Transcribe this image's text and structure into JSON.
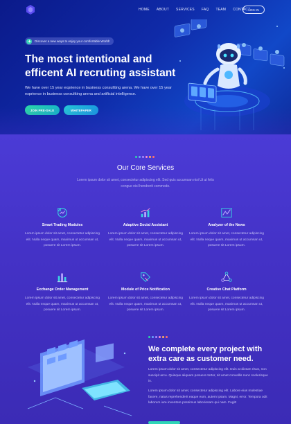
{
  "nav": {
    "items": [
      "HOME",
      "ABOUT",
      "SERVICES",
      "FAQ",
      "TEAM",
      "CONTACT"
    ],
    "login_label": "LOG IN"
  },
  "hero": {
    "pill_text": "Discover a new ways to enjoy your comfortable World!",
    "title": "The most intentional and efficent AI recruting assistant",
    "text": "We have over 15 year exprience in business consultting arena. We have over 15 year exprience in business consultting arena and artificial intelligence.",
    "btn_presale": "JOIN PRE-SALE",
    "btn_whitepaper": "WHITEPAPER"
  },
  "services": {
    "title": "Our Core Services",
    "subtitle": "Lorem ipsum dolor sit amet, consectetur adipiscing elit. Sed quis accumsan nisi Ut ut felis congue nisl hendrerit commodo.",
    "items": [
      {
        "icon": "trading-icon",
        "title": "Smart Trading Modules",
        "text": "Lorem ipsum dolor sit amet, consectetur adipiscing elit. Nulla neque quam, maximus ut accumsan ut, posuere sit Lorem ipsum."
      },
      {
        "icon": "chart-growth-icon",
        "title": "Adaptive Social Assistant",
        "text": "Lorem ipsum dolor sit amet, consectetur adipiscing elit. Nulla neque quam, maximus ut accumsan ut, posuere sit Lorem ipsum."
      },
      {
        "icon": "analytics-icon",
        "title": "Analyzer of the News",
        "text": "Lorem ipsum dolor sit amet, consectetur adipiscing elit. Nulla neque quam, maximus ut accumsan ut, posuere sit Lorem ipsum."
      },
      {
        "icon": "bar-chart-icon",
        "title": "Exchange Order Management",
        "text": "Lorem ipsum dolor sit amet, consectetur adipiscing elit. Nulla neque quam, maximus ut accumsan ut, posuere sit Lorem ipsum."
      },
      {
        "icon": "price-tag-icon",
        "title": "Module of Price Notification",
        "text": "Lorem ipsum dolor sit amet, consectetur adipiscing elit. Nulla neque quam, maximus ut accumsan ut, posuere sit Lorem ipsum."
      },
      {
        "icon": "network-icon",
        "title": "Creative Chat Platform",
        "text": "Lorem ipsum dolor sit amet, consectetur adipiscing elit. Nulla neque quam, maximus ut accumsan ut, posuere sit Lorem ipsum."
      }
    ]
  },
  "cta": {
    "title": "We complete every project with extra care as customer need.",
    "p1": "Lorem ipsum dolor sit amet, consectetur adipiscing elit. Duis at dictum risus, non suscipit arcu. Quisque aliquam posuere tortor, sit amet convallis nunc scelerisque in.",
    "p2": "Lorem ipsum dolor sit amet, consectetur adipiscing elit. Labore eius molestiae facere, natus reprehenderit eaque eum, autem ipsam. Magni, error. Tempora odit laborum iure inventore possimus laboriosam qui nam. Fugit!"
  },
  "colors": {
    "accent_teal": "#2bd6a8",
    "hero_blue": "#0f2aa8",
    "services_purple": "#4432c7"
  }
}
